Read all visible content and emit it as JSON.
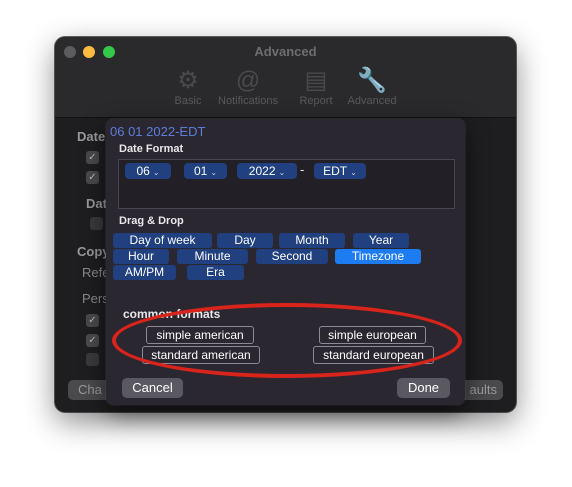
{
  "window": {
    "title": "Advanced",
    "toolbar": [
      {
        "label": "Basic",
        "icon": "gear-icon"
      },
      {
        "label": "Notifications",
        "icon": "at-sign-icon"
      },
      {
        "label": "Report",
        "icon": "document-icon"
      },
      {
        "label": "Advanced",
        "icon": "wrench-icon"
      }
    ],
    "background_labels": [
      "Date",
      "Dat",
      "Copy",
      "Refe",
      "Pers"
    ],
    "left_button": "Cha",
    "right_button": "aults"
  },
  "sheet": {
    "preview": "06 01 2022-EDT",
    "date_format_title": "Date Format",
    "tokens": [
      {
        "value": "06"
      },
      {
        "value": "01"
      },
      {
        "value": "2022"
      },
      {
        "value": "EDT"
      }
    ],
    "separators": [
      "-"
    ],
    "drag_drop_title": "Drag & Drop",
    "chips": [
      {
        "label": "Day of week"
      },
      {
        "label": "Day"
      },
      {
        "label": "Month"
      },
      {
        "label": "Year"
      },
      {
        "label": "Hour"
      },
      {
        "label": "Minute"
      },
      {
        "label": "Second"
      },
      {
        "label": "Timezone"
      },
      {
        "label": "AM/PM"
      },
      {
        "label": "Era"
      }
    ],
    "active_chip": "Timezone",
    "common_formats_title": "common formats",
    "formats": {
      "simple_american": "simple american",
      "simple_european": "simple european",
      "standard_american": "standard american",
      "standard_european": "standard european"
    },
    "cancel_label": "Cancel",
    "done_label": "Done"
  },
  "colors": {
    "accent": "#1d7cf2",
    "chip": "#20407f",
    "highlight": "#d9241b",
    "preview_text": "#5b7fd8"
  }
}
